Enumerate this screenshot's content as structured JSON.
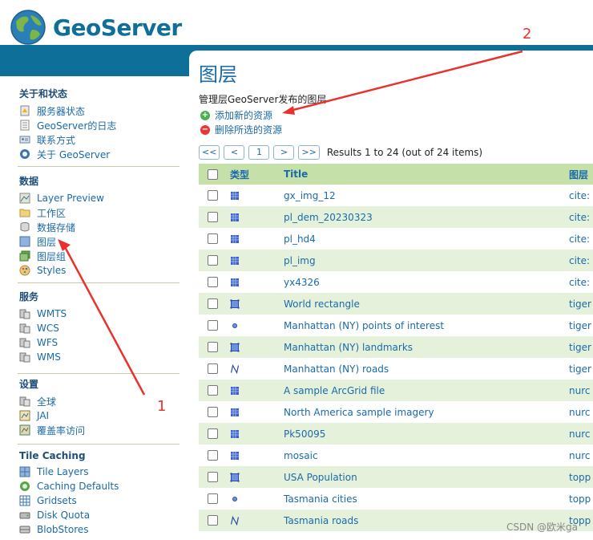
{
  "brand": "GeoServer",
  "sidebar": {
    "sections": [
      {
        "title": "关于和状态",
        "items": [
          {
            "label": "服务器状态",
            "icon": "server-status-icon"
          },
          {
            "label": "GeoServer的日志",
            "icon": "log-icon"
          },
          {
            "label": "联系方式",
            "icon": "contact-icon"
          },
          {
            "label": "关于 GeoServer",
            "icon": "about-icon"
          }
        ]
      },
      {
        "title": "数据",
        "items": [
          {
            "label": "Layer Preview",
            "icon": "layer-preview-icon"
          },
          {
            "label": "工作区",
            "icon": "folder-icon"
          },
          {
            "label": "数据存储",
            "icon": "store-icon"
          },
          {
            "label": "图层",
            "icon": "layer-icon"
          },
          {
            "label": "图层组",
            "icon": "layer-group-icon"
          },
          {
            "label": "Styles",
            "icon": "styles-icon"
          }
        ]
      },
      {
        "title": "服务",
        "items": [
          {
            "label": "WMTS",
            "icon": "service-icon"
          },
          {
            "label": "WCS",
            "icon": "service-icon"
          },
          {
            "label": "WFS",
            "icon": "service-icon"
          },
          {
            "label": "WMS",
            "icon": "service-icon"
          }
        ]
      },
      {
        "title": "设置",
        "items": [
          {
            "label": "全球",
            "icon": "global-settings-icon"
          },
          {
            "label": "JAI",
            "icon": "jai-icon"
          },
          {
            "label": "覆盖率访问",
            "icon": "coverage-access-icon"
          }
        ]
      },
      {
        "title": "Tile Caching",
        "items": [
          {
            "label": "Tile Layers",
            "icon": "tile-layers-icon"
          },
          {
            "label": "Caching Defaults",
            "icon": "caching-defaults-icon"
          },
          {
            "label": "Gridsets",
            "icon": "gridsets-icon"
          },
          {
            "label": "Disk Quota",
            "icon": "disk-quota-icon"
          },
          {
            "label": "BlobStores",
            "icon": "blobstores-icon"
          }
        ]
      }
    ]
  },
  "main": {
    "title": "图层",
    "description": "管理层GeoServer发布的图层",
    "add_label": "添加新的资源",
    "remove_label": "删除所选的资源",
    "pager": {
      "first": "<<",
      "prev": "<",
      "page": "1",
      "next": ">",
      "last": ">>",
      "results": "Results 1 to 24 (out of 24 items)"
    },
    "columns": {
      "type": "类型",
      "title": "Title",
      "layer": "图层"
    },
    "rows": [
      {
        "type": "raster",
        "title": "gx_img_12",
        "layer": "cite:"
      },
      {
        "type": "raster",
        "title": "pl_dem_20230323",
        "layer": "cite:"
      },
      {
        "type": "raster",
        "title": "pl_hd4",
        "layer": "cite:"
      },
      {
        "type": "raster",
        "title": "pl_img",
        "layer": "cite:"
      },
      {
        "type": "raster",
        "title": "yx4326",
        "layer": "cite:"
      },
      {
        "type": "polygon",
        "title": "World rectangle",
        "layer": "tiger"
      },
      {
        "type": "point",
        "title": "Manhattan (NY) points of interest",
        "layer": "tiger"
      },
      {
        "type": "polygon",
        "title": "Manhattan (NY) landmarks",
        "layer": "tiger"
      },
      {
        "type": "line",
        "title": "Manhattan (NY) roads",
        "layer": "tiger"
      },
      {
        "type": "raster",
        "title": "A sample ArcGrid file",
        "layer": "nurc"
      },
      {
        "type": "raster",
        "title": "North America sample imagery",
        "layer": "nurc"
      },
      {
        "type": "raster",
        "title": "Pk50095",
        "layer": "nurc"
      },
      {
        "type": "raster",
        "title": "mosaic",
        "layer": "nurc"
      },
      {
        "type": "polygon",
        "title": "USA Population",
        "layer": "topp"
      },
      {
        "type": "point",
        "title": "Tasmania cities",
        "layer": "topp"
      },
      {
        "type": "line",
        "title": "Tasmania roads",
        "layer": "topp"
      }
    ]
  },
  "annotations": {
    "label1": "1",
    "label2": "2",
    "color": "#e8322b"
  },
  "watermark": "CSDN @欧米ga"
}
